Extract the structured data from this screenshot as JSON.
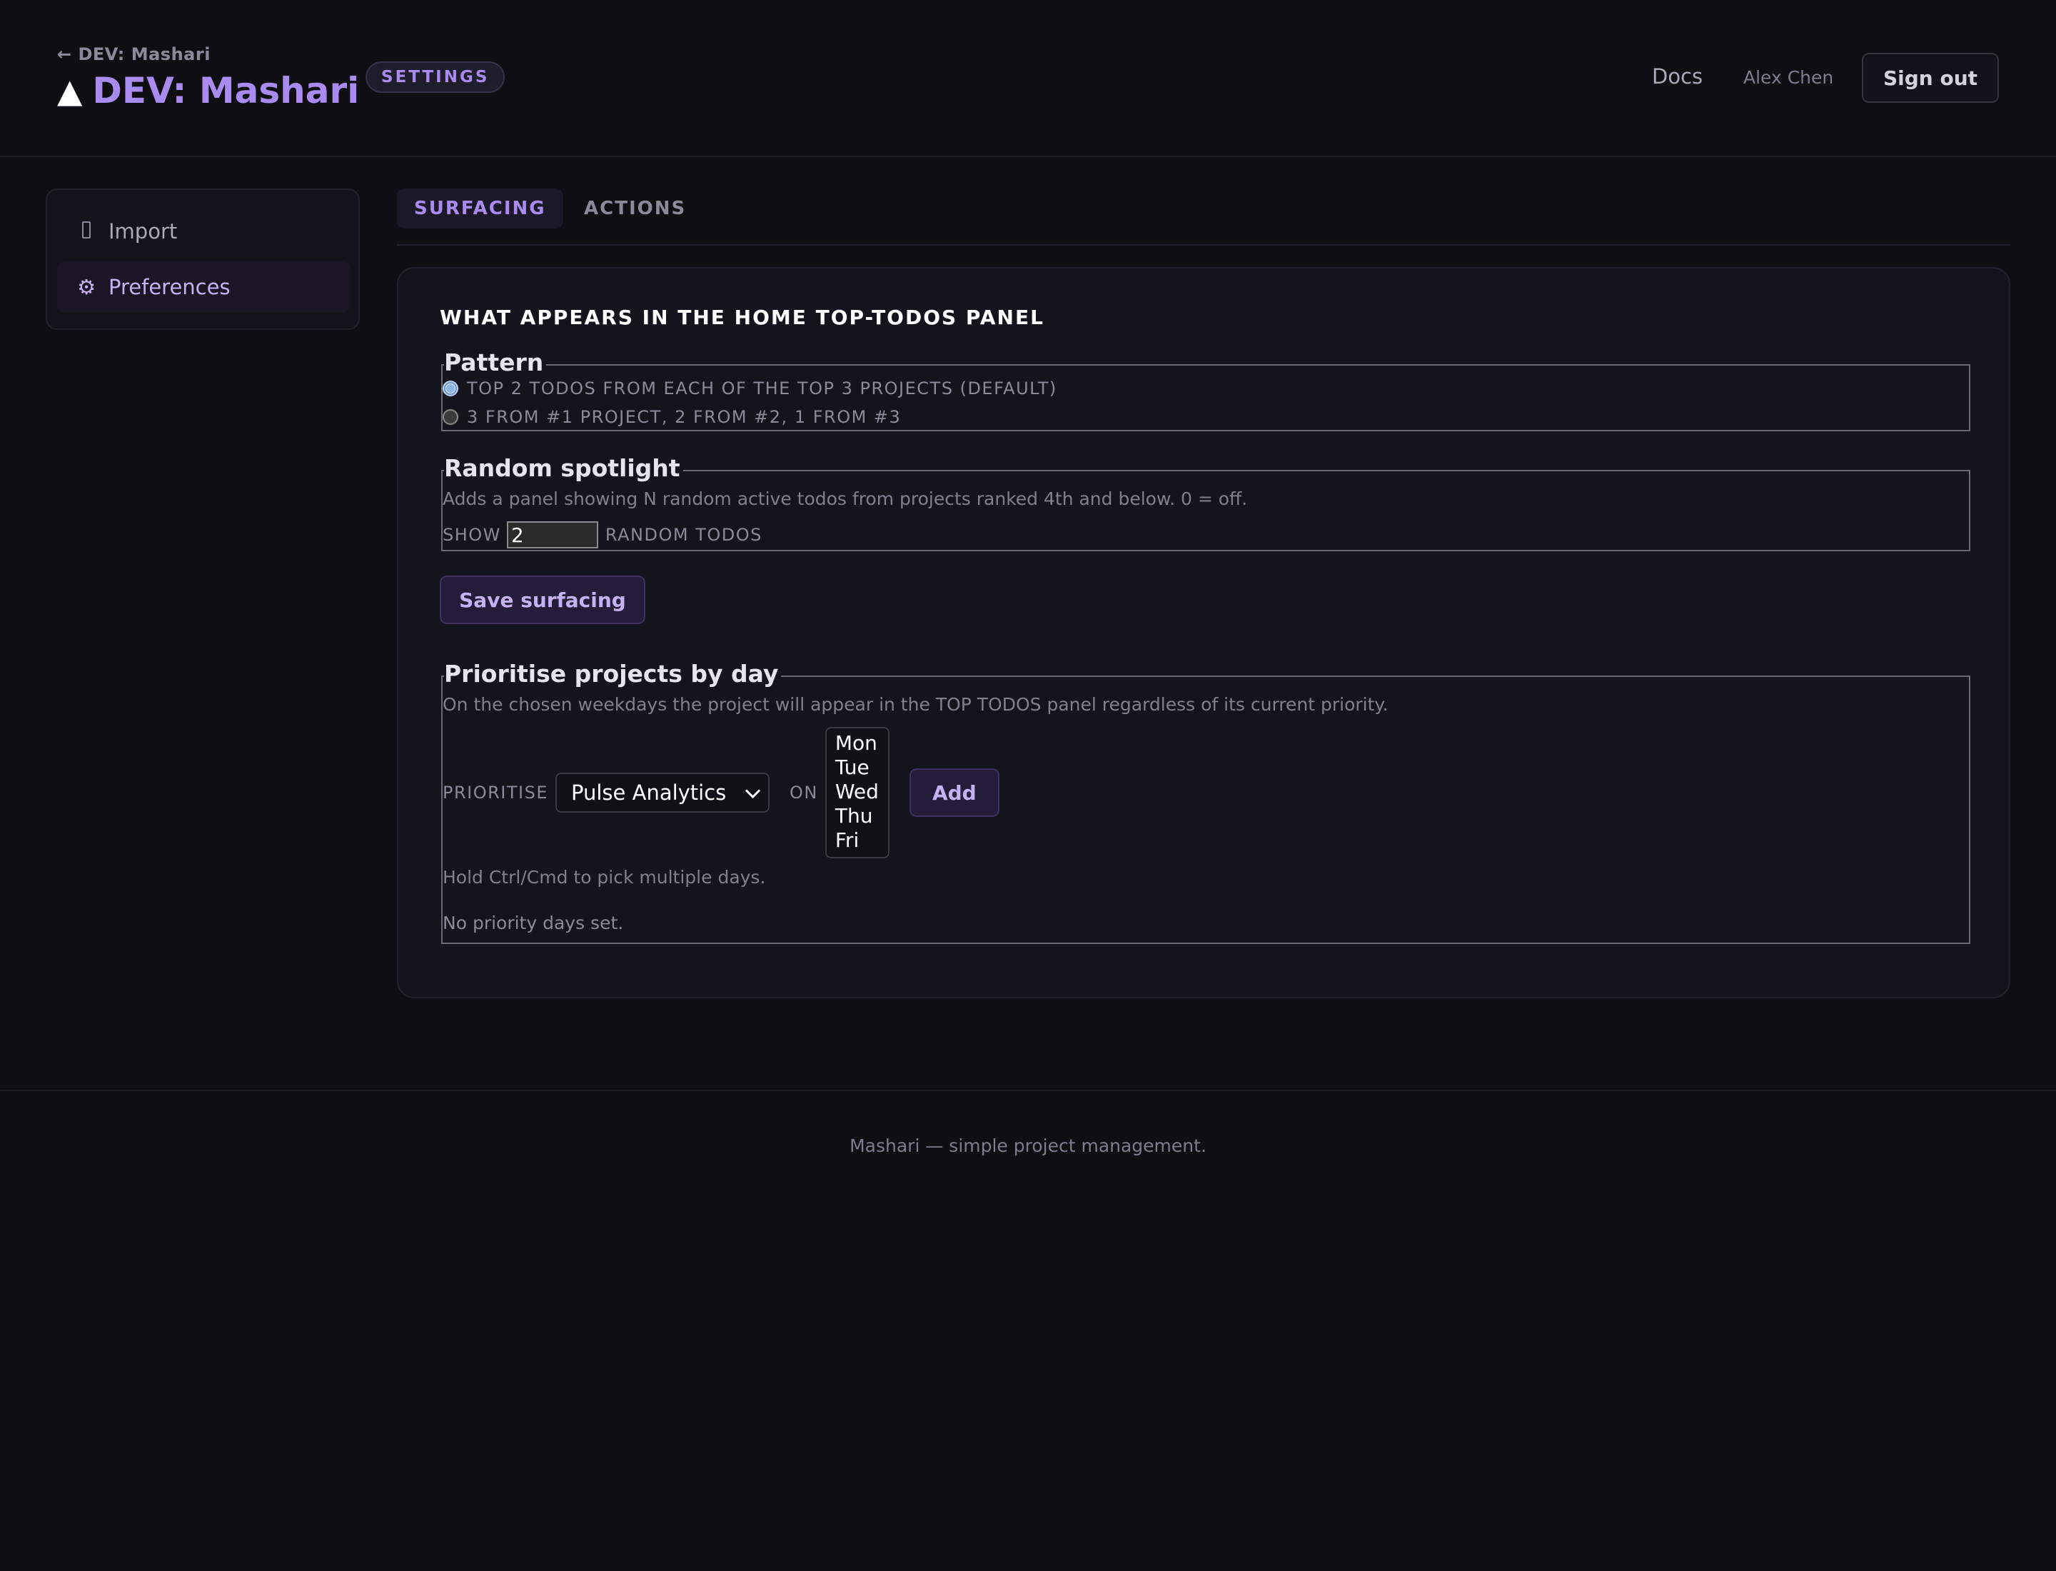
{
  "header": {
    "back_link": "← DEV: Mashari",
    "logo_glyph": "▲",
    "title": "DEV: Mashari",
    "badge": "SETTINGS",
    "nav_docs": "Docs",
    "user_name": "Alex Chen",
    "sign_out": "Sign out"
  },
  "sidebar": {
    "items": [
      {
        "label": "Import",
        "icon": "import-icon"
      },
      {
        "label": "Preferences",
        "icon": "gear-icon",
        "glyph": "⚙"
      }
    ]
  },
  "tabs": [
    {
      "label": "SURFACING",
      "active": true
    },
    {
      "label": "ACTIONS",
      "active": false
    }
  ],
  "card": {
    "heading": "WHAT APPEARS IN THE HOME TOP-TODOS PANEL",
    "pattern": {
      "legend": "Pattern",
      "options": [
        {
          "label": "TOP 2 TODOS FROM EACH OF THE TOP 3 PROJECTS (DEFAULT)",
          "checked": true
        },
        {
          "label": "3 FROM #1 PROJECT, 2 FROM #2, 1 FROM #3",
          "checked": false
        }
      ]
    },
    "random": {
      "legend": "Random spotlight",
      "help": "Adds a panel showing N random active todos from projects ranked 4th and below. 0 = off.",
      "prefix": "SHOW",
      "value": "2",
      "suffix": "RANDOM TODOS"
    },
    "save_label": "Save surfacing",
    "prioritise": {
      "legend": "Prioritise projects by day",
      "help": "On the chosen weekdays the project will appear in the TOP TODOS panel regardless of its current priority.",
      "label": "PRIORITISE",
      "project_selected": "Pulse Analytics",
      "on_label": "ON",
      "days": [
        "Mon",
        "Tue",
        "Wed",
        "Thu",
        "Fri"
      ],
      "add_label": "Add",
      "hint": "Hold Ctrl/Cmd to pick multiple days.",
      "empty": "No priority days set."
    }
  },
  "footer": {
    "text": "Mashari — simple project management."
  },
  "colors": {
    "background": "#0e0e13",
    "card": "#14141c",
    "accent": "#a98bf0",
    "button_bg": "#241d3a"
  }
}
